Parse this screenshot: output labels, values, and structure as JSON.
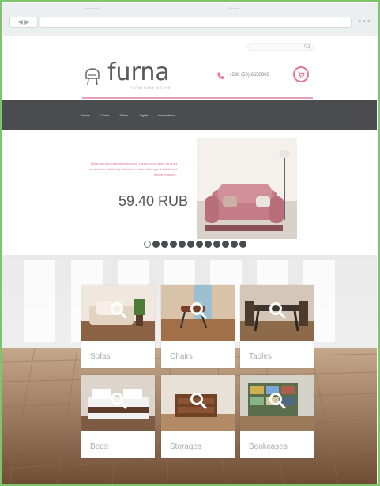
{
  "browser": {
    "nav_label": "◀ ▶",
    "menu_label": "•••"
  },
  "topbar": {
    "left_text": "Home  Info",
    "search_label": "Search"
  },
  "header": {
    "logo_text": "furna",
    "logo_subtitle": "FURNITURE STORE",
    "phone": "+380 (50) 6650003",
    "cart_icon": "cart-icon"
  },
  "nav": {
    "items": [
      "Home",
      "Chairs",
      "Tables",
      "Lights",
      "Home decor"
    ]
  },
  "hero": {
    "promo_text": "Nulla vel nam tristique ligula eget. Lorem ipsum dolor sit amet consectetur adipiscing elit sed do eiusmod tempor incididunt ut labore et dolore.",
    "price": "59.40 RUB",
    "slides_total": 12,
    "active_slide": 1
  },
  "categories": [
    {
      "label": "Sofas"
    },
    {
      "label": "Chairs"
    },
    {
      "label": "Tables"
    },
    {
      "label": "Beds"
    },
    {
      "label": "Storages"
    },
    {
      "label": "Bookcases"
    }
  ],
  "colors": {
    "accent": "#e8748f",
    "nav_bg": "#4a4c50",
    "frame": "#7cc56a"
  }
}
